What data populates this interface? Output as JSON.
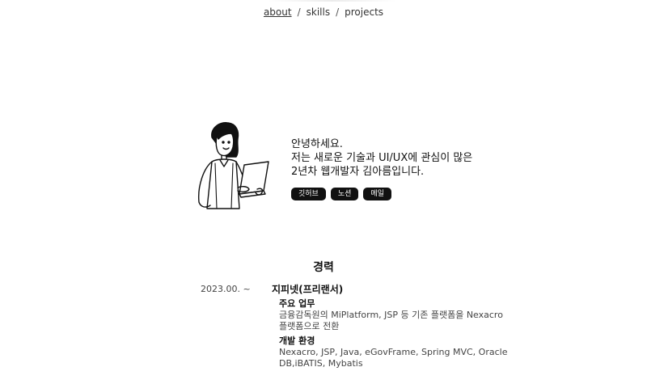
{
  "nav": {
    "items": [
      "about",
      "skills",
      "projects"
    ],
    "separator": "/",
    "active": "about"
  },
  "hero": {
    "greeting": "안녕하세요.",
    "line2": "저는 새로운 기술과 UI/UX에 관심이 많은",
    "line3": "2년차 웹개발자 김아름입니다.",
    "buttons": [
      "깃허브",
      "노션",
      "메일"
    ]
  },
  "career": {
    "title": "경력",
    "entry": {
      "period": "2023.00. ~",
      "company": "지피넷(프리랜서)",
      "duties_heading": "주요 업무",
      "duties_text": "금융감독원의 MiPlatform, JSP 등 기존 플랫폼을 Nexacro 플랫폼으로 전환",
      "env_heading": "개발 환경",
      "env_text": "Nexacro, JSP, Java, eGovFrame, Spring MVC, Oracle DB,iBATIS, Mybatis"
    }
  },
  "colors": {
    "text": "#111111",
    "muted": "#444444",
    "pill_bg": "#111111",
    "pill_text": "#ffffff"
  }
}
